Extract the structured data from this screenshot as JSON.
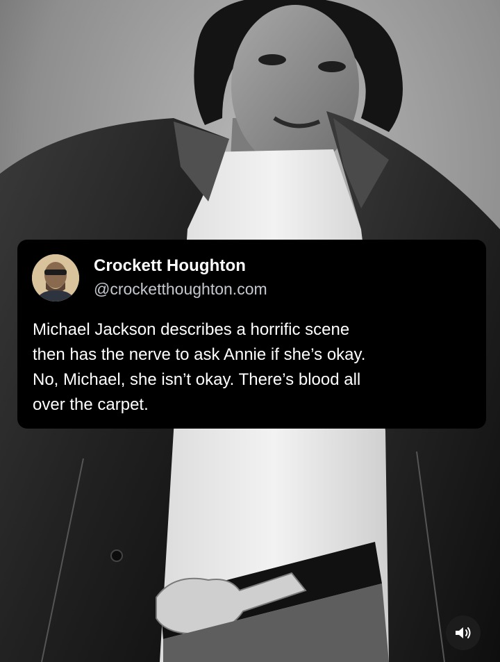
{
  "background": {
    "image": "person-photo"
  },
  "post": {
    "avatar_icon": "avatar",
    "author": "Crockett Houghton",
    "handle": "@crocketthoughton.com",
    "text_lines": [
      "Michael Jackson describes a horrific scene",
      "then has the nerve to ask Annie if she’s okay.",
      "No, Michael, she isn’t okay. There’s blood all",
      "over the carpet."
    ]
  },
  "controls": {
    "sound_icon": "speaker-volume-icon"
  },
  "colors": {
    "card_background": "#000000",
    "handle_text": "#c4c8cf",
    "text": "#ffffff"
  }
}
